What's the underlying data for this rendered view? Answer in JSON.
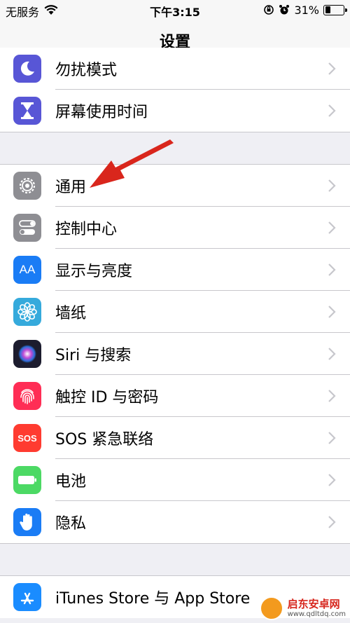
{
  "status_bar": {
    "carrier": "无服务",
    "time": "下午3:15",
    "battery": "31%",
    "battery_level": 0.31
  },
  "nav": {
    "title": "设置"
  },
  "groups": [
    {
      "items": [
        {
          "label": "勿扰模式",
          "icon": "moon-icon",
          "color": "#5856d6"
        },
        {
          "label": "屏幕使用时间",
          "icon": "hourglass-icon",
          "color": "#5856d6"
        }
      ]
    },
    {
      "items": [
        {
          "label": "通用",
          "icon": "gear-icon",
          "color": "#8e8e93"
        },
        {
          "label": "控制中心",
          "icon": "toggle-icon",
          "color": "#8e8e93"
        },
        {
          "label": "显示与亮度",
          "icon": "text-size-icon",
          "color": "#1a7cf5",
          "icon_text": "AA"
        },
        {
          "label": "墙纸",
          "icon": "flower-icon",
          "color": "#35aadc"
        },
        {
          "label": "Siri 与搜索",
          "icon": "siri-icon",
          "color": "#1c1c2e"
        },
        {
          "label": "触控 ID 与密码",
          "icon": "fingerprint-icon",
          "color": "#ff2d55"
        },
        {
          "label": "SOS 紧急联络",
          "icon": "sos-icon",
          "color": "#ff3b30",
          "icon_text": "SOS"
        },
        {
          "label": "电池",
          "icon": "battery-icon",
          "color": "#4cd964"
        },
        {
          "label": "隐私",
          "icon": "hand-icon",
          "color": "#1a7cf5"
        }
      ]
    },
    {
      "items": [
        {
          "label": "iTunes Store 与 App Store",
          "icon": "app-store-icon",
          "color": "#1a8cff"
        }
      ]
    }
  ],
  "annotation": {
    "arrow_color": "#d9261c"
  },
  "watermark": {
    "name": "启东安卓网",
    "url": "www.qdltdq.com"
  }
}
